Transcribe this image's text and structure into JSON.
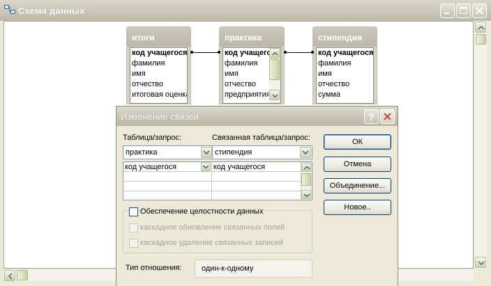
{
  "window": {
    "title": "Схема данных",
    "controls": {
      "minimize": "minimize",
      "maximize": "maximize",
      "close": "close"
    }
  },
  "tables": [
    {
      "name": "итоги",
      "fields": [
        "код учащегося",
        "фамилия",
        "имя",
        "отчество",
        "итоговая оценка"
      ],
      "scroll": false
    },
    {
      "name": "практика",
      "fields": [
        "код учащегося",
        "фамилия",
        "имя",
        "отчество",
        "предприятия"
      ],
      "scroll": true
    },
    {
      "name": "стипендия",
      "fields": [
        "код учащегося",
        "фамилия",
        "имя",
        "отчество",
        "сумма"
      ],
      "scroll": false
    }
  ],
  "dialog": {
    "title": "Изменение связей",
    "table_label": "Таблица/запрос:",
    "related_label": "Связанная таблица/запрос:",
    "table_value": "практика",
    "related_value": "стипендия",
    "grid": {
      "left_field": "код учащегося",
      "right_field": "код учащегося"
    },
    "buttons": {
      "ok": "ОК",
      "cancel": "Отмена",
      "join": "Объединение...",
      "new": "Новое.."
    },
    "integrity_label": "Обеспечение целостности данных",
    "cascade_update_label": "каскадное обновление связанных полей",
    "cascade_delete_label": "каскадное удаление связанных записей",
    "relation_type_label": "Тип отношения:",
    "relation_type_value": "один-к-одному"
  },
  "colors": {
    "title_bar": "#c9c5b6",
    "button_border": "#003c74",
    "close_red": "#c74a3c"
  }
}
